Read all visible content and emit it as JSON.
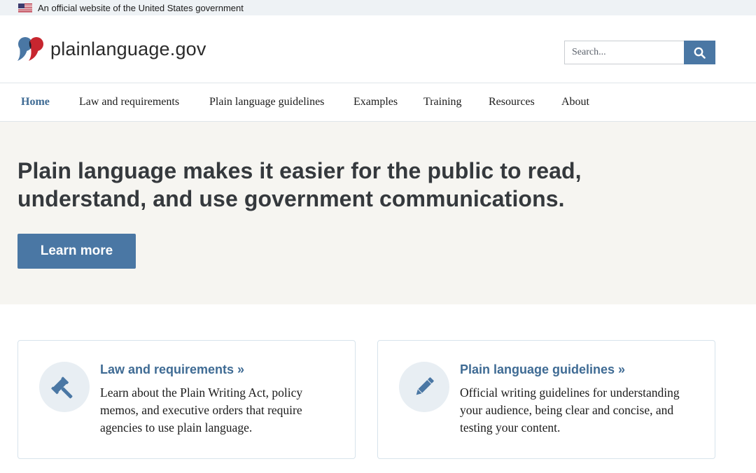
{
  "gov_banner": {
    "flag_icon": "us-flag-icon",
    "text": "An official website of the United States government"
  },
  "header": {
    "logo_icon": "quote-marks-logo-icon",
    "logo_text": "plainlanguage.gov",
    "search": {
      "placeholder": "Search...",
      "value": "",
      "button_icon": "search-icon"
    }
  },
  "nav": {
    "items": [
      {
        "label": "Home",
        "active": true
      },
      {
        "label": "Law and requirements",
        "active": false
      },
      {
        "label": "Plain language guidelines",
        "active": false
      },
      {
        "label": "Examples",
        "active": false
      },
      {
        "label": "Training",
        "active": false
      },
      {
        "label": "Resources",
        "active": false
      },
      {
        "label": "About",
        "active": false
      }
    ]
  },
  "hero": {
    "title": "Plain language makes it easier for the public to read, understand, and use government communications.",
    "button_label": "Learn more"
  },
  "cards": [
    {
      "icon": "gavel-icon",
      "title": "Law and requirements »",
      "text": "Learn about the Plain Writing Act, policy memos, and executive orders that require agencies to use plain language."
    },
    {
      "icon": "pencil-icon",
      "title": "Plain language guidelines »",
      "text": "Official writing guidelines for understanding your audience, being clear and concise, and testing your content."
    }
  ],
  "colors": {
    "accent": "#4a77a4",
    "link": "#3f6b94",
    "hero_bg": "#f6f5f1",
    "banner_bg": "#eef2f5",
    "logo_red": "#c7262f",
    "logo_blue": "#4a77a4"
  }
}
